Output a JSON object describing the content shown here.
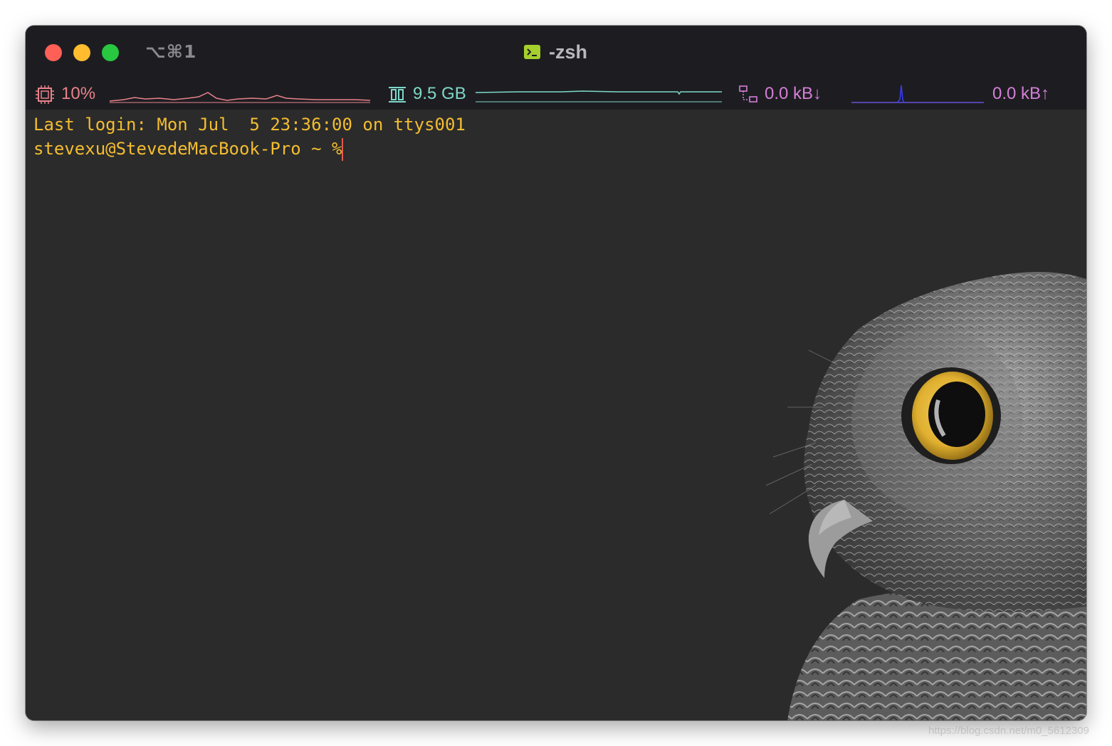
{
  "window": {
    "shortcut": "⌥⌘1",
    "title": "-zsh"
  },
  "statusbar": {
    "cpu": {
      "label": "10%",
      "color": "#e8828a"
    },
    "memory": {
      "label": "9.5 GB",
      "color": "#7fd8c9"
    },
    "network_down": {
      "label": "0.0 kB↓",
      "color": "#d57ed8"
    },
    "network_up": {
      "label": "0.0 kB↑",
      "color": "#d57ed8"
    }
  },
  "terminal": {
    "lines": [
      "Last login: Mon Jul  5 23:36:00 on ttys001",
      "stevexu@StevedeMacBook-Pro ~ % "
    ],
    "text_color": "#f4bd31",
    "background_color": "#2b2b2b",
    "cursor_color": "#e5584f"
  },
  "watermark": "https://blog.csdn.net/m0_5612309"
}
